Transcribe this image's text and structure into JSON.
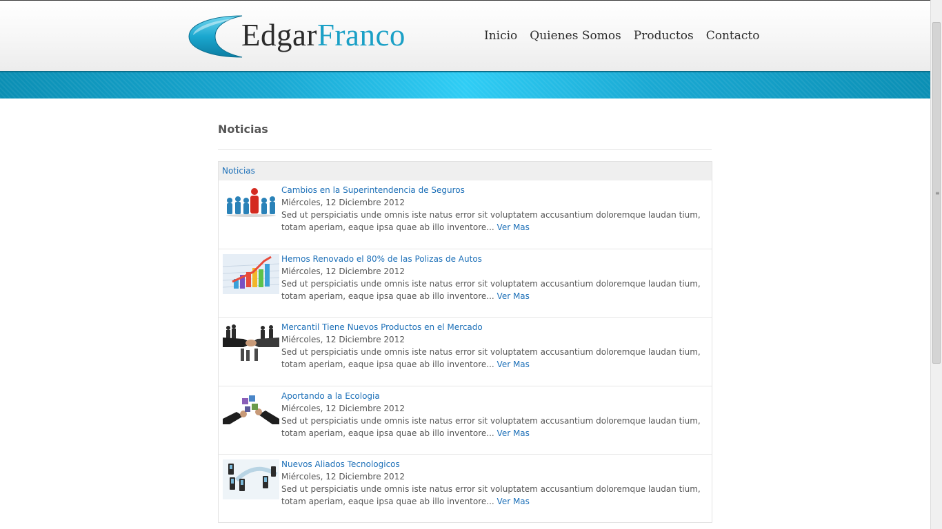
{
  "brand": {
    "name_first": "Edgar",
    "name_second": "Franco",
    "accent": "#1ba0c6"
  },
  "nav": {
    "items": [
      {
        "label": "Inicio"
      },
      {
        "label": "Quienes Somos"
      },
      {
        "label": "Productos"
      },
      {
        "label": "Contacto"
      }
    ]
  },
  "main": {
    "title": "Noticias",
    "box_header": "Noticias",
    "news": [
      {
        "title": "Cambios en la Superintendencia de Seguros",
        "date": "Miércoles, 12 Diciembre 2012",
        "excerpt": "Sed ut perspiciatis unde omnis iste natus error sit voluptatem accusantium doloremque laudan tium, totam aperiam, eaque ipsa quae ab illo inventore...",
        "more": "Ver Mas"
      },
      {
        "title": "Hemos Renovado el 80% de las Polizas de Autos",
        "date": "Miércoles, 12 Diciembre 2012",
        "excerpt": "Sed ut perspiciatis unde omnis iste natus error sit voluptatem accusantium doloremque laudan tium, totam aperiam, eaque ipsa quae ab illo inventore...",
        "more": "Ver Mas"
      },
      {
        "title": "Mercantil Tiene Nuevos Productos en el Mercado",
        "date": "Miércoles, 12 Diciembre 2012",
        "excerpt": "Sed ut perspiciatis unde omnis iste natus error sit voluptatem accusantium doloremque laudan tium, totam aperiam, eaque ipsa quae ab illo inventore...",
        "more": "Ver Mas"
      },
      {
        "title": "Aportando a la Ecologia",
        "date": "Miércoles, 12 Diciembre 2012",
        "excerpt": "Sed ut perspiciatis unde omnis iste natus error sit voluptatem accusantium doloremque laudan tium, totam aperiam, eaque ipsa quae ab illo inventore...",
        "more": "Ver Mas"
      },
      {
        "title": "Nuevos Aliados Tecnologicos",
        "date": "Miércoles, 12 Diciembre 2012",
        "excerpt": "Sed ut perspiciatis unde omnis iste natus error sit voluptatem accusantium doloremque laudan tium, totam aperiam, eaque ipsa quae ab illo inventore...",
        "more": "Ver Mas"
      }
    ]
  }
}
